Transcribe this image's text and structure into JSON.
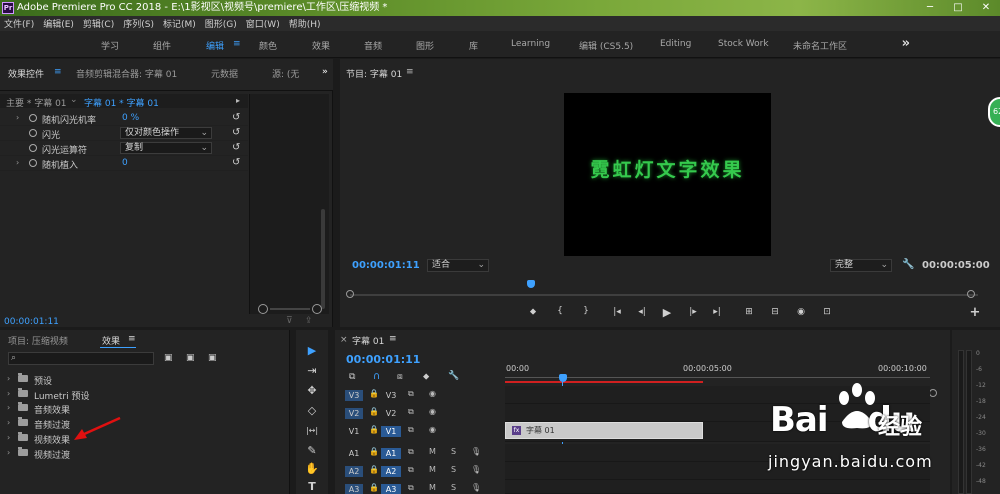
{
  "titlebar": {
    "title": "Adobe Premiere Pro CC 2018 - E:\\1影视区\\视频号\\premiere\\工作区\\压缩视频 *",
    "logo": "Pr",
    "win_min": "─",
    "win_max": "□",
    "win_close": "✕"
  },
  "menubar": [
    "文件(F)",
    "编辑(E)",
    "剪辑(C)",
    "序列(S)",
    "标记(M)",
    "图形(G)",
    "窗口(W)",
    "帮助(H)"
  ],
  "workspaces": [
    "学习",
    "组件",
    "编辑",
    "颜色",
    "效果",
    "音频",
    "图形",
    "库",
    "Learning",
    "编辑 (CS5.5)",
    "Editing",
    "Stock Work",
    "未命名工作区"
  ],
  "workspace_active": "编辑",
  "workspace_menu": "≡",
  "workspace_more": "»",
  "effect_controls": {
    "tabs": [
      "效果控件",
      "音频剪辑混合器: 字幕 01",
      "元数据",
      "源: (无"
    ],
    "menu_icon": "≡",
    "more": "»",
    "sub_master": "主要 * 字幕 01",
    "sub_clip": "字幕 01 * 字幕 01",
    "rows": [
      {
        "name": "随机闪光机率",
        "value": "0 %",
        "type": "value",
        "arrow": "›"
      },
      {
        "name": "闪光",
        "value": "仅对颜色操作",
        "type": "dropdown",
        "arrow": ""
      },
      {
        "name": "闪光运算符",
        "value": "复制",
        "type": "dropdown",
        "arrow": ""
      },
      {
        "name": "随机植入",
        "value": "0",
        "type": "value",
        "arrow": "›"
      }
    ],
    "timecode": "00:00:01:11"
  },
  "program_monitor": {
    "title": "节目: 字幕 01",
    "menu_icon": "≡",
    "video_text": "霓虹灯文字效果",
    "timecode": "00:00:01:11",
    "fit": "适合",
    "quality": "完整",
    "duration": "00:00:05:00",
    "controls": [
      "⬥",
      "{",
      "}",
      "|◂",
      "◂|",
      "▶",
      "|▸",
      "▸|",
      "⊞",
      "⊟",
      "◉",
      "⊡",
      "+"
    ]
  },
  "project": {
    "tabs": [
      "项目: 压缩视频",
      "效果"
    ],
    "menu_icon": "≡",
    "folders": [
      "预设",
      "Lumetri 预设",
      "音频效果",
      "音频过渡",
      "视频效果",
      "视频过渡"
    ]
  },
  "tools": [
    "▶",
    "⇥",
    "✥",
    "◇",
    "|↔|",
    "✎",
    "✋",
    "T"
  ],
  "timeline": {
    "close": "×",
    "tab": "字幕 01",
    "menu_icon": "≡",
    "timecode": "00:00:01:11",
    "ruler": [
      "00:00",
      "00:00:05:00",
      "00:00:10:00"
    ],
    "tracks": [
      {
        "label": "V3",
        "target": "V3",
        "type": "video",
        "src_sel": true,
        "tgt_sel": false
      },
      {
        "label": "V2",
        "target": "V2",
        "type": "video",
        "src_sel": true,
        "tgt_sel": false
      },
      {
        "label": "V1",
        "target": "V1",
        "type": "video",
        "src_sel": false,
        "tgt_sel": true
      },
      {
        "label": "A1",
        "target": "A1",
        "type": "audio",
        "src_sel": false,
        "tgt_sel": true
      },
      {
        "label": "A2",
        "target": "A2",
        "type": "audio",
        "src_sel": true,
        "tgt_sel": true
      },
      {
        "label": "A3",
        "target": "A3",
        "type": "audio",
        "src_sel": true,
        "tgt_sel": true
      }
    ],
    "clip_label": "字幕 01",
    "clip_fx": "fx"
  },
  "meter": {
    "values": [
      "0",
      "-6",
      "-12",
      "-18",
      "-24",
      "-30",
      "-36",
      "-42",
      "-48"
    ]
  },
  "watermark": {
    "brand": "Bai",
    "brand2": "du",
    "jy": "经验",
    "url": "jingyan.baidu.com"
  },
  "badge": "62",
  "colors": {
    "accent": "#3ea1ff",
    "neon_text": "#35c94d",
    "playhead": "#3ea1ff",
    "work_area": "#d02020"
  }
}
